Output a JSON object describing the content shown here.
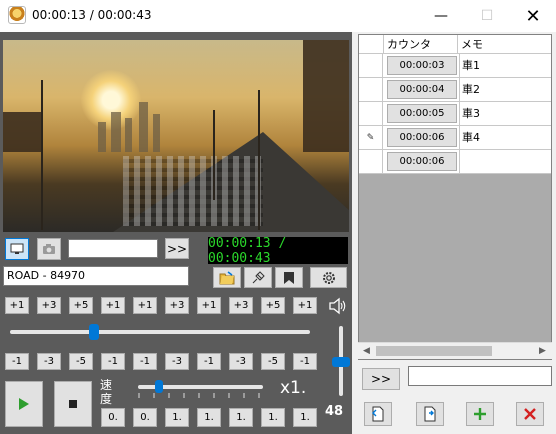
{
  "window": {
    "title": "00:00:13 / 00:00:43",
    "min_glyph": "—",
    "max_glyph": "☐",
    "close_glyph": "✕"
  },
  "player": {
    "skip_label": ">>",
    "timecode": "00:00:13 / 00:00:43",
    "clip_name": "ROAD - 84970",
    "forward_steps": [
      "+1",
      "+3",
      "+5",
      "+1",
      "+1",
      "+3",
      "+1",
      "+3",
      "+5",
      "+1"
    ],
    "back_steps": [
      "-1",
      "-3",
      "-5",
      "-1",
      "-1",
      "-3",
      "-1",
      "-3",
      "-5",
      "-1"
    ],
    "position_fraction": 0.28,
    "speed_label": "速度",
    "speed_value": "x1.",
    "speed_fraction": 0.17,
    "preset_speeds": [
      "0.",
      "0.",
      "1.",
      "1.",
      "1.",
      "1.",
      "1.",
      "1."
    ],
    "volume_value": "48",
    "volume_fraction": 0.48
  },
  "marks": {
    "columns": [
      "カウンタ",
      "メモ"
    ],
    "rows": [
      {
        "counter": "00:00:03",
        "memo": "車1",
        "marker": ""
      },
      {
        "counter": "00:00:04",
        "memo": "車2",
        "marker": ""
      },
      {
        "counter": "00:00:05",
        "memo": "車3",
        "marker": ""
      },
      {
        "counter": "00:00:06",
        "memo": "車4",
        "marker": "✎"
      },
      {
        "counter": "00:00:06",
        "memo": "",
        "marker": ""
      }
    ],
    "skip_label": ">>",
    "scroll_left": "◀",
    "scroll_right": "▶"
  },
  "colors": {
    "timecode_green": "#2bd92b",
    "accent_blue": "#0078d7",
    "add_green": "#2e9e2e",
    "delete_red": "#d42020"
  }
}
